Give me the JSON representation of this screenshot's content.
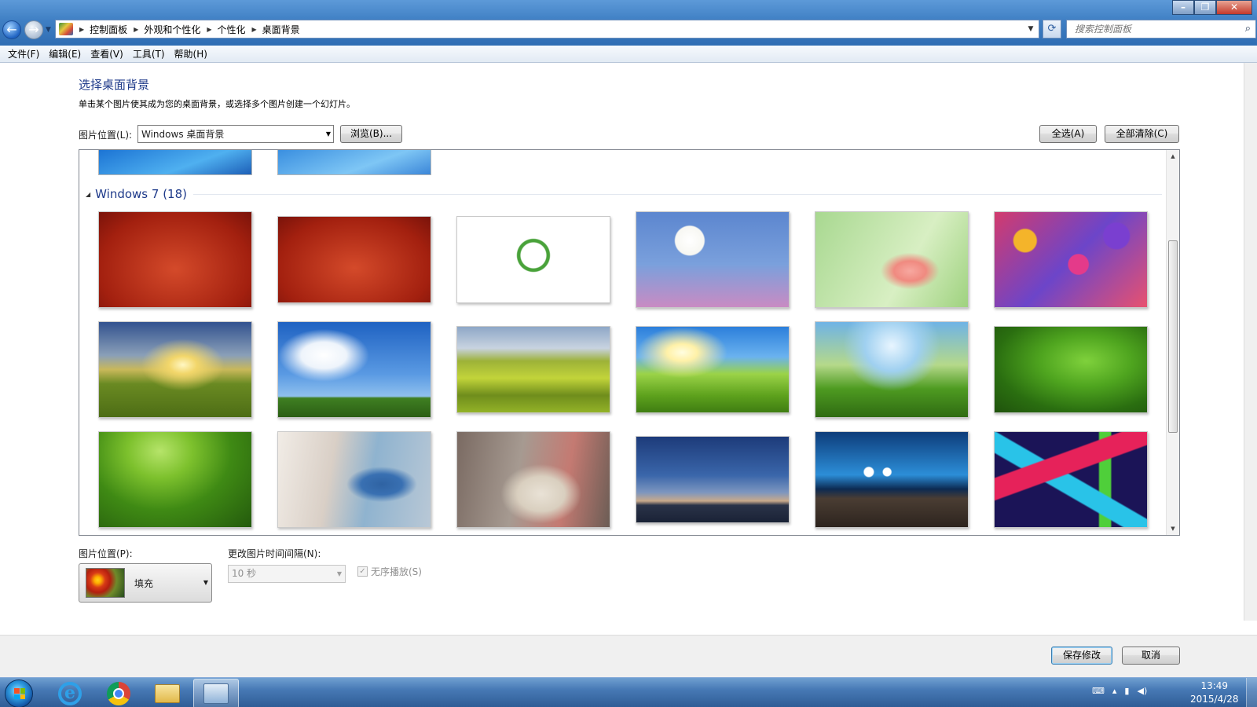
{
  "address_bar": {
    "crumbs": [
      "控制面板",
      "外观和个性化",
      "个性化",
      "桌面背景"
    ],
    "search_placeholder": "搜索控制面板"
  },
  "window_buttons": {
    "minimize": "–",
    "maximize": "❐",
    "close": "✕"
  },
  "menu": [
    "文件(F)",
    "编辑(E)",
    "查看(V)",
    "工具(T)",
    "帮助(H)"
  ],
  "page": {
    "title": "选择桌面背景",
    "description": "单击某个图片使其成为您的桌面背景，或选择多个图片创建一个幻灯片。"
  },
  "picture_location": {
    "label": "图片位置(L):",
    "value": "Windows 桌面背景",
    "browse": "浏览(B)...",
    "select_all": "全选(A)",
    "clear_all": "全部清除(C)"
  },
  "gallery": {
    "group_title": "Windows 7 (18)",
    "thumbnails": [
      "red-labor-day-1",
      "red-labor-day-2",
      "colorful-circle-logo",
      "daisy-flowers",
      "pink-lily",
      "colorful-flowers",
      "sunrise-field",
      "blue-sky-clouds",
      "rolling-green-hills",
      "green-hill-sunburst",
      "grass-closeup",
      "green-leaf-droplets",
      "lotus-leaves",
      "girl-blue-dress",
      "girl-white-coat",
      "evening-sky-sea",
      "bokeh-lights-wood",
      "geometric-colors"
    ]
  },
  "picture_position": {
    "label": "图片位置(P):",
    "value": "填充"
  },
  "interval": {
    "label": "更改图片时间间隔(N):",
    "value": "10 秒"
  },
  "shuffle": {
    "label": "无序播放(S)",
    "checked": true
  },
  "footer": {
    "save": "保存修改",
    "cancel": "取消"
  },
  "taskbar": {
    "apps": [
      "internet-explorer",
      "chrome",
      "file-explorer",
      "control-panel"
    ],
    "time": "13:49",
    "date": "2015/4/28"
  }
}
